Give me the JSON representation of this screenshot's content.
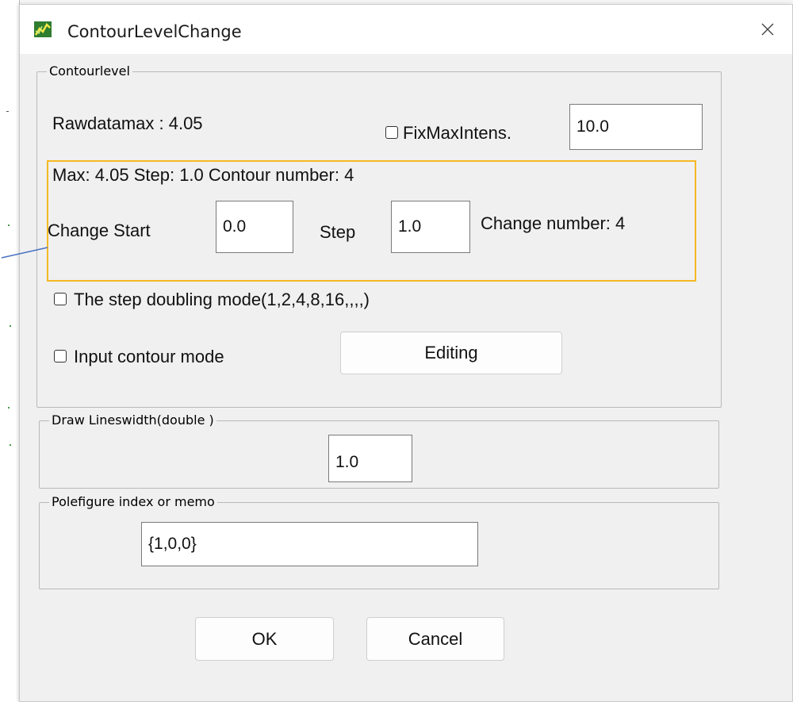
{
  "dialog": {
    "title": "ContourLevelChange",
    "app_icon": "chart-icon",
    "close_icon": "close-icon"
  },
  "contour_group": {
    "legend": "Contourlevel",
    "rawdatamax_label": "Rawdatamax : 4.05",
    "fix_max_label": "FixMaxIntens.",
    "fix_max_checked": false,
    "fix_max_value": "10.0",
    "summary": "Max: 4.05  Step: 1.0  Contour number: 4",
    "change_start_label": "Change Start",
    "change_start_value": "0.0",
    "step_label": "Step",
    "step_value": "1.0",
    "change_number_label": "Change number: 4",
    "doubling_label": "The step doubling mode(1,2,4,8,16,,,,)",
    "doubling_checked": false,
    "input_mode_label": "Input contour mode",
    "input_mode_checked": false,
    "editing_button": "Editing"
  },
  "linewidth_group": {
    "legend": "Draw Lineswidth(double )",
    "value": "1.0"
  },
  "memo_group": {
    "legend": "Polefigure index or memo",
    "value": "{1,0,0}"
  },
  "buttons": {
    "ok": "OK",
    "cancel": "Cancel"
  },
  "colors": {
    "highlight": "#f5b823",
    "pointer_line": "#4a72c4",
    "dialog_bg": "#f0f0f0"
  }
}
